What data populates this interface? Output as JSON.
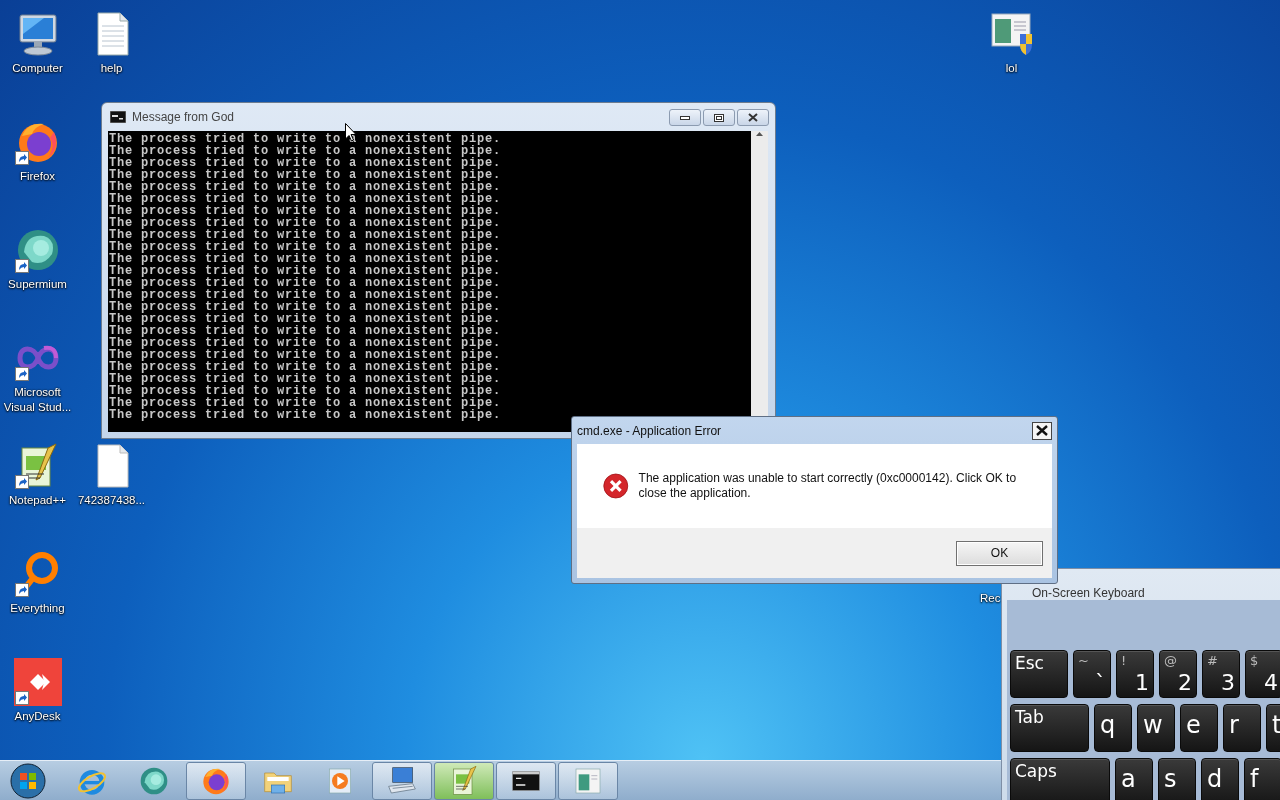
{
  "desktop_icons": [
    {
      "label": "Computer",
      "kind": "computer",
      "shortcut": false
    },
    {
      "label": "help",
      "kind": "document",
      "shortcut": false
    },
    {
      "label": "Firefox",
      "kind": "firefox",
      "shortcut": true
    },
    {
      "label": "Supermium",
      "kind": "supermium",
      "shortcut": true
    },
    {
      "label": "Microsoft Visual Stud...",
      "kind": "visualstudio",
      "shortcut": true
    },
    {
      "label": "Notepad++",
      "kind": "notepad",
      "shortcut": true
    },
    {
      "label": "742387438...",
      "kind": "blank",
      "shortcut": false
    },
    {
      "label": "Everything",
      "kind": "everything",
      "shortcut": true
    },
    {
      "label": "AnyDesk",
      "kind": "anydesk",
      "shortcut": true
    },
    {
      "label": "lol",
      "kind": "shieldwindow",
      "shortcut": false
    },
    {
      "label": "Rec",
      "kind": "hidden"
    }
  ],
  "console_window": {
    "title": "Message from God",
    "lines": [
      "The process tried to write to a nonexistent pipe.",
      "The process tried to write to a nonexistent pipe.",
      "The process tried to write to a nonexistent pipe.",
      "The process tried to write to a nonexistent pipe.",
      "The process tried to write to a nonexistent pipe.",
      "The process tried to write to a nonexistent pipe.",
      "The process tried to write to a nonexistent pipe.",
      "The process tried to write to a nonexistent pipe.",
      "The process tried to write to a nonexistent pipe.",
      "The process tried to write to a nonexistent pipe.",
      "The process tried to write to a nonexistent pipe.",
      "The process tried to write to a nonexistent pipe.",
      "The process tried to write to a nonexistent pipe.",
      "The process tried to write to a nonexistent pipe.",
      "The process tried to write to a nonexistent pipe.",
      "The process tried to write to a nonexistent pipe.",
      "The process tried to write to a nonexistent pipe.",
      "The process tried to write to a nonexistent pipe.",
      "The process tried to write to a nonexistent pipe.",
      "The process tried to write to a nonexistent pipe.",
      "The process tried to write to a nonexistent pipe.",
      "The process tried to write to a nonexistent pipe.",
      "The process tried to write to a nonexistent pipe.",
      "The process tried to write to a nonexistent pipe."
    ]
  },
  "error_dialog": {
    "title": "cmd.exe - Application Error",
    "message": "The application was unable to start correctly (0xc0000142). Click OK to close the application.",
    "button": "OK"
  },
  "on_screen_keyboard": {
    "title": "On-Screen Keyboard",
    "rows": [
      [
        {
          "kind": "function",
          "label": "Esc"
        },
        {
          "kind": "dual",
          "shift": "~",
          "label": "`"
        },
        {
          "kind": "dual",
          "shift": "!",
          "label": "1"
        },
        {
          "kind": "dual",
          "shift": "@",
          "label": "2"
        },
        {
          "kind": "dual",
          "shift": "#",
          "label": "3"
        },
        {
          "kind": "dual",
          "shift": "$",
          "label": "4"
        }
      ],
      [
        {
          "kind": "function",
          "label": "Tab"
        },
        {
          "kind": "char",
          "label": "q"
        },
        {
          "kind": "char",
          "label": "w"
        },
        {
          "kind": "char",
          "label": "e"
        },
        {
          "kind": "char",
          "label": "r"
        },
        {
          "kind": "char",
          "label": "t"
        }
      ],
      [
        {
          "kind": "function",
          "label": "Caps"
        },
        {
          "kind": "char",
          "label": "a"
        },
        {
          "kind": "char",
          "label": "s"
        },
        {
          "kind": "char",
          "label": "d"
        },
        {
          "kind": "char",
          "label": "f"
        }
      ]
    ]
  },
  "taskbar": {
    "items": [
      {
        "kind": "ie",
        "open": false,
        "hover": false
      },
      {
        "kind": "supermium",
        "open": false,
        "hover": false
      },
      {
        "kind": "firefox",
        "open": true,
        "hover": false
      },
      {
        "kind": "explorer",
        "open": false,
        "hover": false
      },
      {
        "kind": "media",
        "open": false,
        "hover": false
      },
      {
        "kind": "keyboard",
        "open": true,
        "hover": false
      },
      {
        "kind": "notepad",
        "open": true,
        "hover": true
      },
      {
        "kind": "cmd",
        "open": true,
        "hover": false
      },
      {
        "kind": "appwindow",
        "open": true,
        "hover": false
      }
    ]
  }
}
